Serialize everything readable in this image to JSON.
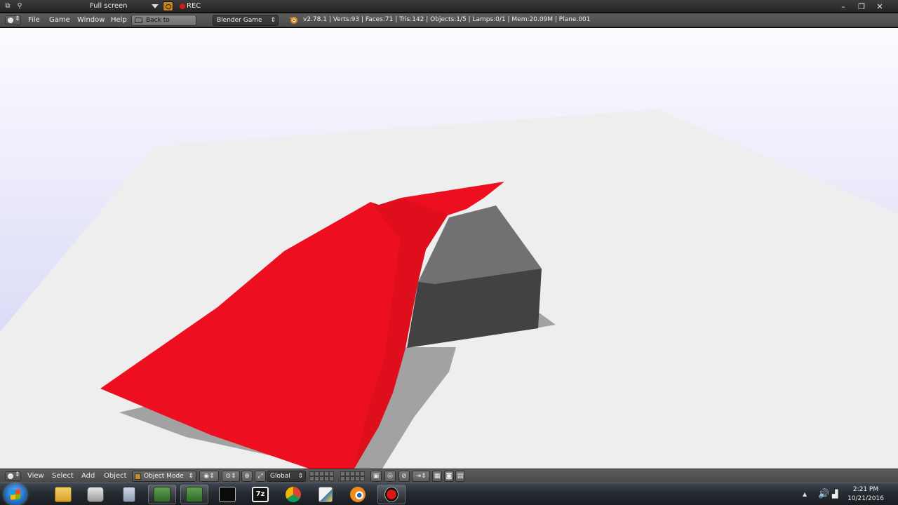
{
  "recorder": {
    "mode_label": "Full screen",
    "rec_label": "REC",
    "icons": [
      "window-icon",
      "zoom-icon",
      "dropdown-caret-icon",
      "camera-icon",
      "record-dot-icon"
    ],
    "window_controls": {
      "minimize": "–",
      "maximize": "❐",
      "close": "✕"
    }
  },
  "blender_header": {
    "menus": [
      "File",
      "Game",
      "Window",
      "Help"
    ],
    "back_button": "Back to Previous",
    "engine": "Blender Game",
    "stats": "v2.78.1 | Verts:93 | Faces:71 | Tris:142 | Objects:1/5 | Lamps:0/1 | Mem:20.09M | Plane.001"
  },
  "viewport": {
    "colors": {
      "sky_top": "#fbfbff",
      "sky_bottom": "#cdcdf4",
      "ground": "#eeeeee",
      "shadow": "#a2a2a2",
      "cloth": "#ed0f1f",
      "cube_top": "#717171",
      "cube_side": "#424242"
    }
  },
  "view3d_header": {
    "menus": [
      "View",
      "Select",
      "Add",
      "Object"
    ],
    "mode": "Object Mode",
    "orientation": "Global"
  },
  "taskbar": {
    "apps": [
      "explorer-icon",
      "camera-app-icon",
      "calculator-icon",
      "remote-desktop-icon",
      "remote-desktop-2-icon",
      "terminal-icon",
      "7zip-icon",
      "chrome-icon",
      "python-icon",
      "blender-icon",
      "recorder-icon"
    ],
    "time": "2:21 PM",
    "date": "10/21/2016"
  }
}
